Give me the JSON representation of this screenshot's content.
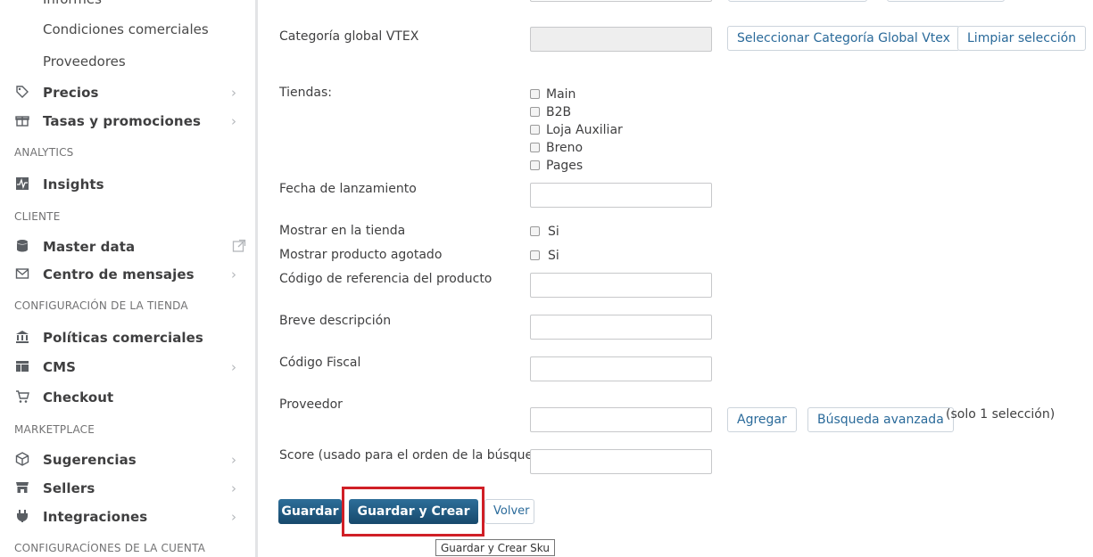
{
  "sidebar": {
    "sub_items": [
      "Informes",
      "Condiciones comerciales",
      "Proveedores"
    ],
    "items": [
      {
        "label": "Precios",
        "icon": "tag-icon",
        "chevron": true
      },
      {
        "label": "Tasas y promociones",
        "icon": "gift-icon",
        "chevron": true
      },
      {
        "label": "Insights",
        "icon": "activity-icon",
        "chevron": false
      },
      {
        "label": "Master data",
        "icon": "database-icon",
        "external": true
      },
      {
        "label": "Centro de mensajes",
        "icon": "mail-icon",
        "chevron": true
      },
      {
        "label": "Políticas comerciales",
        "icon": "bank-icon",
        "chevron": false
      },
      {
        "label": "CMS",
        "icon": "layout-icon",
        "chevron": true
      },
      {
        "label": "Checkout",
        "icon": "cart-icon",
        "chevron": false
      },
      {
        "label": "Sugerencias",
        "icon": "box-icon",
        "chevron": true
      },
      {
        "label": "Sellers",
        "icon": "store-icon",
        "chevron": true
      },
      {
        "label": "Integraciones",
        "icon": "plug-icon",
        "chevron": true
      }
    ],
    "sections": [
      "ANALYTICS",
      "CLIENTE",
      "CONFIGURACIÓN DE LA TIENDA",
      "MARKETPLACE",
      "CONFIGURACÍONES DE LA CUENTA"
    ]
  },
  "form": {
    "categoria_label": "Categoría global VTEX",
    "categoria_value": "",
    "select_category_button": "Seleccionar Categoría Global Vtex",
    "clear_selection_button": "Limpiar selección",
    "tiendas_label": "Tiendas:",
    "tiendas": [
      "Main",
      "B2B",
      "Loja Auxiliar",
      "Breno",
      "Pages"
    ],
    "fecha_label": "Fecha de lanzamiento",
    "mostrar_label": "Mostrar en la tienda",
    "mostrar_option": "Si",
    "agotado_label": "Mostrar producto agotado",
    "agotado_option": "Si",
    "codigo_ref_label": "Código de referencia del producto",
    "breve_label": "Breve descripción",
    "fiscal_label": "Código Fiscal",
    "proveedor_label": "Proveedor",
    "agregar_button": "Agregar",
    "busqueda_button": "Búsqueda avanzada",
    "solo_note": "(solo 1 selección)",
    "score_label": "Score (usado para el orden de la búsqueda)"
  },
  "actions": {
    "guardar": "Guardar",
    "guardar_crear_sku": "Guardar y Crear Sku",
    "volver": "Volver",
    "tooltip": "Guardar y Crear Sku"
  },
  "colors": {
    "primary_button": "#1e577d",
    "link": "#2a6a9a",
    "highlight": "#d01f26"
  }
}
